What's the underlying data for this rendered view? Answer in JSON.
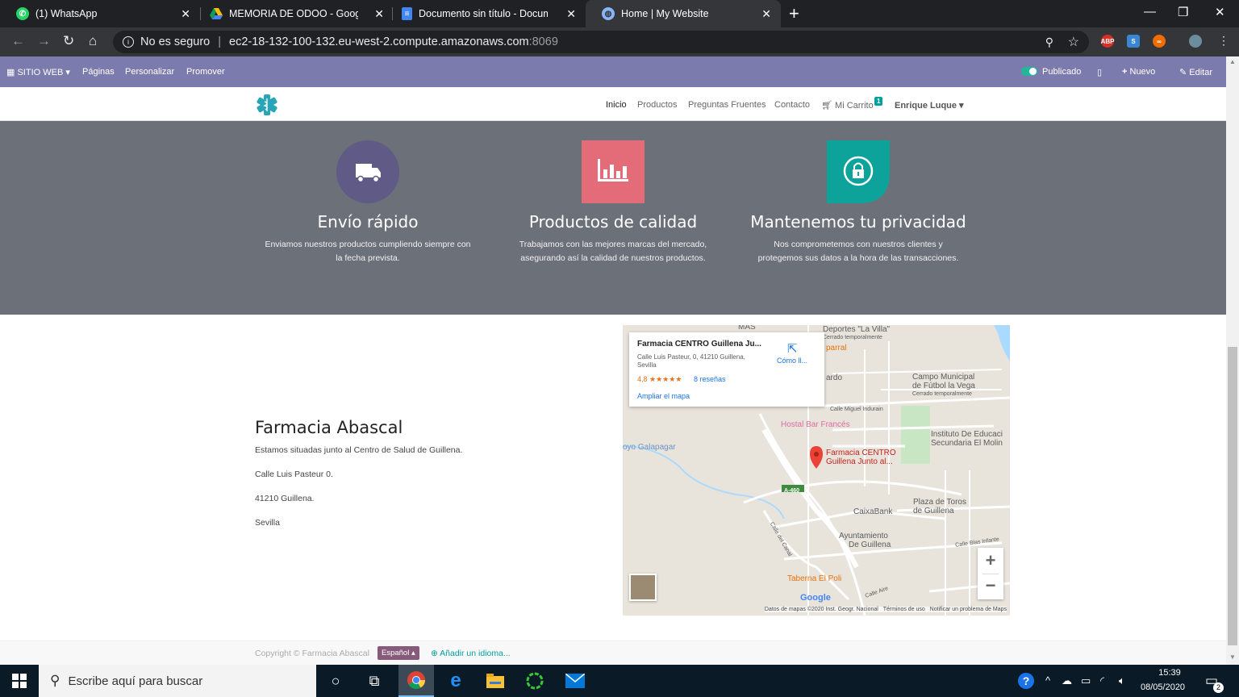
{
  "browser": {
    "tabs": [
      {
        "title": "(1) WhatsApp",
        "icon": "whatsapp-icon"
      },
      {
        "title": "MEMORIA DE ODOO - Google D",
        "icon": "google-drive-icon"
      },
      {
        "title": "Documento sin título - Documen",
        "icon": "google-docs-icon"
      },
      {
        "title": "Home | My Website",
        "icon": "globe-icon",
        "active": true
      }
    ],
    "security_label": "No es seguro",
    "url_host": "ec2-18-132-100-132.eu-west-2.compute.amazonaws.com",
    "url_port": ":8069",
    "extensions": [
      "ABP",
      "S",
      "∞"
    ]
  },
  "odoo_bar": {
    "site_menu": "SITIO WEB",
    "pages": "Páginas",
    "customize": "Personalizar",
    "promote": "Promover",
    "published": "Publicado",
    "new": "Nuevo",
    "edit": "Editar"
  },
  "site_nav": {
    "items": [
      "Inicio",
      "Productos",
      "Preguntas Fruentes",
      "Contacto"
    ],
    "cart": "Mi Carrito",
    "cart_count": "1",
    "user": "Enrique Luque"
  },
  "features": [
    {
      "title": "Envío rápido",
      "text1": "Enviamos nuestros productos cumpliendo siempre con",
      "text2": "la fecha prevista.",
      "color": "#5f5a86"
    },
    {
      "title": "Productos de calidad",
      "text1": "Trabajamos con las mejores marcas del mercado,",
      "text2": "asegurando así la calidad de nuestros productos.",
      "color": "#e46b78"
    },
    {
      "title": "Mantenemos tu privacidad",
      "text1": "Nos comprometemos con nuestros clientes y",
      "text2": "protegemos sus datos a la hora de las transacciones.",
      "color": "#0ea39a"
    }
  ],
  "contact": {
    "title": "Farmacia Abascal",
    "line1": "Estamos situadas junto al Centro de Salud de Guillena.",
    "line2": "Calle Luis Pasteur 0.",
    "line3": "41210 Guillena.",
    "line4": "Sevilla"
  },
  "map": {
    "place_name": "Farmacia CENTRO Guillena Ju...",
    "address1": "Calle Luis Pasteur, 0, 41210 Guillena,",
    "address2": "Sevilla",
    "rating": "4,8",
    "stars": "★★★★★",
    "reviews": "8 reseñas",
    "enlarge": "Ampliar el mapa",
    "directions": "Cómo ll...",
    "labels": {
      "mas": "MAS",
      "deportes": "Deportes \"La Villa\"",
      "deportes_sub": "Cerrado temporalmente",
      "parral": "parral",
      "campo": "Campo Municipal",
      "campo2": "de Fútbol la Vega",
      "campo_sub": "Cerrado temporalmente",
      "ardo": "ardo",
      "miguel": "Calle Miguel Indurain",
      "hostal": "Hostal Bar Francés",
      "instituto": "Instituto De Educaci",
      "instituto2": "Secundaria El Molin",
      "arroyo": "oyo Galapagar",
      "farmacia": "Farmacia CENTRO",
      "farmacia2": "Guillena Junto al...",
      "a460": "A-460",
      "plaza": "Plaza de Toros",
      "plaza2": "de Guillena",
      "caixa": "CaixaBank",
      "ayto": "Ayuntamiento",
      "ayto2": "De Guillena",
      "canal": "Calle del Canal",
      "blas": "Calle Blas Infante",
      "taberna": "Taberna El Poli",
      "aire": "Calle Aire",
      "google": "Google"
    },
    "attribution": "Datos de mapas ©2020 Inst. Geogr. Nacional",
    "terms": "Términos de uso",
    "report": "Notificar un problema de Maps"
  },
  "footer": {
    "copyright": "Copyright © Farmacia Abascal",
    "language": "Español",
    "add_language": "Añadir un idioma..."
  },
  "taskbar": {
    "search_placeholder": "Escribe aquí para buscar",
    "time": "15:39",
    "date": "08/05/2020",
    "notifications": "2"
  }
}
